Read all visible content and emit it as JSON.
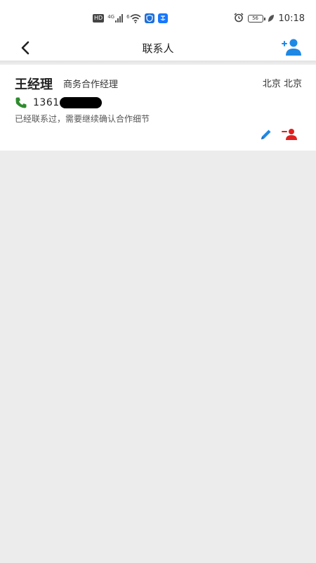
{
  "status_bar": {
    "time": "10:18",
    "network_label": "HD",
    "signal_label": "4G",
    "wifi_label": "6",
    "battery_label": "56"
  },
  "header": {
    "title": "联系人"
  },
  "contact": {
    "name": "王经理",
    "position": "商务合作经理",
    "location": "北京 北京",
    "phone": "1361",
    "note": "已经联系过，需要继续确认合作细节"
  },
  "colors": {
    "accent": "#1e88e5",
    "phone_icon": "#2e8b2e",
    "danger": "#e02020",
    "background": "#ececec"
  }
}
